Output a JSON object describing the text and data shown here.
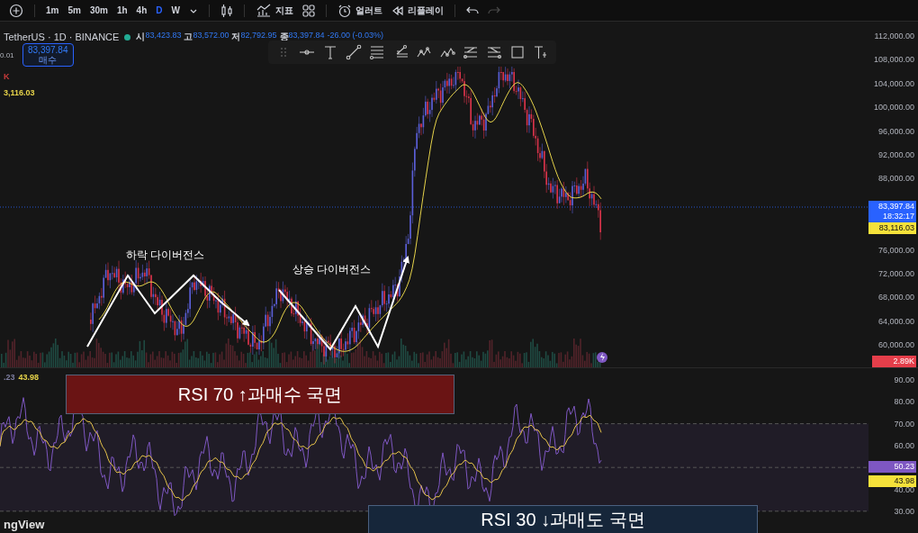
{
  "toolbar": {
    "timeframes": [
      {
        "label": "1m",
        "selected": false
      },
      {
        "label": "5m",
        "selected": false
      },
      {
        "label": "30m",
        "selected": false
      },
      {
        "label": "1h",
        "selected": false
      },
      {
        "label": "4h",
        "selected": false
      },
      {
        "label": "D",
        "selected": true
      },
      {
        "label": "W",
        "selected": false
      }
    ],
    "indicators_label": "지표",
    "alert_label": "얼러트",
    "replay_label": "리플레이",
    "redo_disabled": true
  },
  "legend": {
    "symbol": "TetherUS · 1D · BINANCE",
    "market_open": true,
    "ohlc": [
      {
        "key": "시",
        "value": "83,423.83"
      },
      {
        "key": "고",
        "value": "83,572.00"
      },
      {
        "key": "저",
        "value": "82,792.95"
      },
      {
        "key": "종",
        "value": "83,397.84"
      }
    ],
    "change": "-26.00 (-0.03%)",
    "spread": "0.01",
    "buy_price": "83,397.84",
    "buy_label": "매수",
    "volume_value": "K",
    "ma_value": "3,116.03"
  },
  "price_axis": {
    "labels": [
      "112,000.00",
      "108,000.00",
      "104,000.00",
      "100,000.00",
      "96,000.00",
      "92,000.00",
      "88,000.00",
      "76,000.00",
      "72,000.00",
      "68,000.00",
      "64,000.00",
      "60,000.00"
    ],
    "last_price": "83,397.84",
    "countdown": "18:32:17",
    "ma_price": "83,116.03",
    "volume": "2.89K"
  },
  "annotations": [
    {
      "text": "하락 다이버전스"
    },
    {
      "text": "상승 다이버전스"
    }
  ],
  "rsi": {
    "legend_value": ".23",
    "ma_value": "43.98",
    "axis_labels": [
      "90.00",
      "80.00",
      "70.00",
      "60.00",
      "40.00",
      "30.00"
    ],
    "rsi_badge": "50.23",
    "ma_badge": "43.98",
    "callouts": [
      {
        "kind": "overbought",
        "text": "RSI 70 ↑과매수 국면"
      },
      {
        "kind": "oversold",
        "text": "RSI 30 ↓과매도 국면"
      }
    ]
  },
  "logo_text": "ngView"
}
